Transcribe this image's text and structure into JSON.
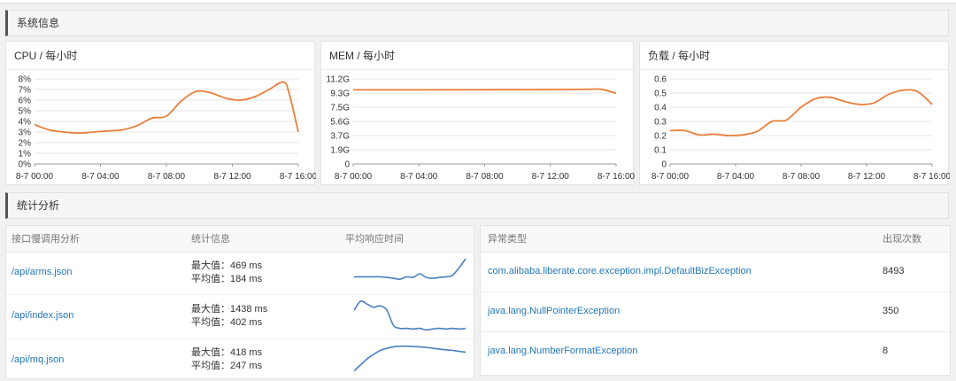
{
  "section1": {
    "title": "系统信息"
  },
  "section2": {
    "title": "统计分析"
  },
  "charts": [
    {
      "title": "CPU / 每小时",
      "color": "#e97f3b",
      "chart_data": {
        "type": "line",
        "xlabel": "",
        "ylabel": "",
        "x_ticks": [
          "8-7 00:00",
          "8-7 04:00",
          "8-7 08:00",
          "8-7 12:00",
          "8-7 16:00"
        ],
        "y_ticks": [
          "8%",
          "7%",
          "6%",
          "5%",
          "4%",
          "3%",
          "2%",
          "1%",
          "0%"
        ],
        "ylim": [
          0,
          8
        ],
        "series": [
          {
            "x": [
              0,
              1,
              2,
              3,
              4,
              5,
              6,
              7,
              8,
              9,
              10,
              11,
              12,
              13,
              14,
              15,
              16,
              17,
              17.4,
              18
            ],
            "y": [
              3.7,
              3.2,
              3.0,
              2.9,
              3.0,
              3.1,
              3.2,
              3.6,
              4.3,
              4.5,
              5.9,
              6.8,
              6.7,
              6.2,
              6.0,
              6.3,
              7.0,
              7.7,
              6.5,
              3.0
            ]
          }
        ]
      }
    },
    {
      "title": "MEM / 每小时",
      "color": "#e97f3b",
      "chart_data": {
        "type": "line",
        "xlabel": "",
        "ylabel": "",
        "x_ticks": [
          "8-7 00:00",
          "8-7 04:00",
          "8-7 08:00",
          "8-7 12:00",
          "8-7 16:00"
        ],
        "y_ticks": [
          "11.2G",
          "9.3G",
          "7.5G",
          "5.6G",
          "3.7G",
          "1.9G",
          "0"
        ],
        "ylim": [
          0,
          11.2
        ],
        "series": [
          {
            "x": [
              0,
              2,
              4,
              6,
              8,
              10,
              12,
              14,
              16,
              17,
              18
            ],
            "y": [
              9.75,
              9.75,
              9.75,
              9.76,
              9.77,
              9.78,
              9.79,
              9.8,
              9.82,
              9.82,
              9.3
            ]
          }
        ]
      }
    },
    {
      "title": "负载 / 每小时",
      "color": "#e97f3b",
      "chart_data": {
        "type": "line",
        "xlabel": "",
        "ylabel": "",
        "x_ticks": [
          "8-7 00:00",
          "8-7 04:00",
          "8-7 08:00",
          "8-7 12:00",
          "8-7 16:00"
        ],
        "y_ticks": [
          "0.6",
          "0.5",
          "0.4",
          "0.3",
          "0.2",
          "0.1",
          "0"
        ],
        "ylim": [
          0,
          0.6
        ],
        "series": [
          {
            "x": [
              0,
              1,
              2,
              3,
              4,
              5,
              6,
              7,
              8,
              9,
              10,
              11,
              12,
              13,
              14,
              15,
              16,
              17,
              18
            ],
            "y": [
              0.235,
              0.235,
              0.205,
              0.21,
              0.2,
              0.205,
              0.23,
              0.3,
              0.31,
              0.4,
              0.46,
              0.47,
              0.44,
              0.42,
              0.43,
              0.49,
              0.52,
              0.51,
              0.42
            ]
          }
        ]
      }
    }
  ],
  "api_table": {
    "headers": [
      "接口慢调用分析",
      "统计信息",
      "平均响应时间"
    ],
    "rows": [
      {
        "path": "/api/arms.json",
        "max": "最大值：469 ms",
        "avg": "平均值：184 ms",
        "spark": [
          0.6,
          0.6,
          0.6,
          0.6,
          0.6,
          0.62,
          0.65,
          0.68,
          0.6,
          0.62,
          0.5,
          0.62,
          0.65,
          0.62,
          0.6,
          0.55,
          0.3,
          0.0
        ]
      },
      {
        "path": "/api/index.json",
        "max": "最大值：1438 ms",
        "avg": "平均值：402 ms",
        "spark": [
          0.3,
          0.0,
          0.1,
          0.2,
          0.15,
          0.3,
          0.8,
          0.9,
          0.9,
          0.92,
          0.9,
          0.95,
          0.92,
          0.9,
          0.92,
          0.9,
          0.92,
          0.9
        ]
      },
      {
        "path": "/api/mq.json",
        "max": "最大值：418 ms",
        "avg": "平均值：247 ms",
        "spark": [
          0.9,
          0.7,
          0.5,
          0.35,
          0.22,
          0.15,
          0.1,
          0.08,
          0.08,
          0.09,
          0.1,
          0.12,
          0.15,
          0.18,
          0.2,
          0.22,
          0.25,
          0.28
        ]
      }
    ],
    "spark_color": "#4a7fc1"
  },
  "exception_table": {
    "headers": [
      "异常类型",
      "出现次数"
    ],
    "rows": [
      {
        "type": "com.alibaba.liberate.core.exception.impl.DefaultBizException",
        "count": "8493"
      },
      {
        "type": "java.lang.NullPointerException",
        "count": "350"
      },
      {
        "type": "java.lang.NumberFormatException",
        "count": "8"
      }
    ]
  }
}
